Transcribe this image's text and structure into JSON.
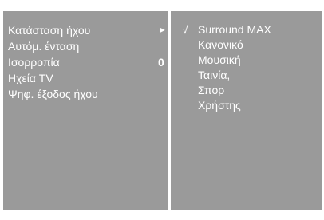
{
  "sound_menu": {
    "items": [
      {
        "label": "Κατάσταση ήχου",
        "indicator": "►"
      },
      {
        "label": "Αυτόμ. ένταση",
        "indicator": ""
      },
      {
        "label": "Ισορροπία",
        "indicator": "0"
      },
      {
        "label": "Ηχεία TV",
        "indicator": ""
      },
      {
        "label": "Ψηφ. έξοδος ήχου",
        "indicator": ""
      }
    ]
  },
  "sound_mode_submenu": {
    "check_mark": "√",
    "options": [
      {
        "label": "Surround MAX",
        "selected": true
      },
      {
        "label": "Κανονικό",
        "selected": false
      },
      {
        "label": "Μουσική",
        "selected": false
      },
      {
        "label": "Ταινία,",
        "selected": false
      },
      {
        "label": "Σπορ",
        "selected": false
      },
      {
        "label": "Χρήστης",
        "selected": false
      }
    ]
  },
  "colors": {
    "panel_background": "#9a9a9a",
    "text": "#ffffff",
    "page_background": "#ffffff"
  }
}
